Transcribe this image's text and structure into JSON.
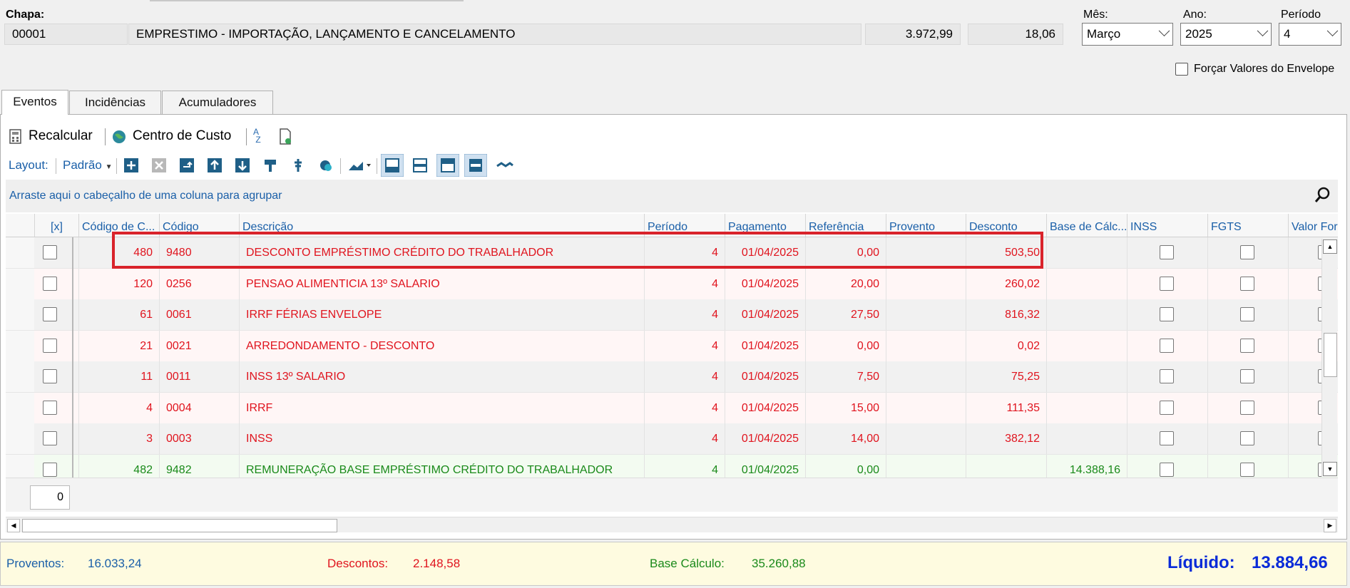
{
  "header": {
    "chapa_label": "Chapa:",
    "chapa_code": "00001",
    "chapa_name": "EMPRESTIMO - IMPORTAÇÃO, LANÇAMENTO E CANCELAMENTO",
    "value1": "3.972,99",
    "value2": "18,06",
    "mes_label": "Mês:",
    "mes_value": "Março",
    "ano_label": "Ano:",
    "ano_value": "2025",
    "periodo_label": "Período",
    "periodo_value": "4",
    "forcar_label": "Forçar Valores do Envelope"
  },
  "tabs": [
    {
      "label": "Eventos"
    },
    {
      "label": "Incidências"
    },
    {
      "label": "Acumuladores"
    }
  ],
  "toolbar": {
    "recalcular": "Recalcular",
    "centro_custo": "Centro de Custo",
    "layout_label": "Layout:",
    "layout_value": "Padrão"
  },
  "group_hint": "Arraste aqui o cabeçalho de uma coluna para agrupar",
  "columns": [
    "[x]",
    "Código de C...",
    "Código",
    "Descrição",
    "Período",
    "Pagamento",
    "Referência",
    "Provento",
    "Desconto",
    "Base de Cálc...",
    "INSS",
    "FGTS",
    "Valor Força"
  ],
  "rows": [
    {
      "cc": "480",
      "code": "9480",
      "desc": "DESCONTO EMPRÉSTIMO CRÉDITO DO TRABALHADOR",
      "periodo": "4",
      "pagamento": "01/04/2025",
      "referencia": "0,00",
      "provento": "",
      "desconto": "503,50",
      "base": ""
    },
    {
      "cc": "120",
      "code": "0256",
      "desc": "PENSAO ALIMENTICIA 13º SALARIO",
      "periodo": "4",
      "pagamento": "01/04/2025",
      "referencia": "20,00",
      "provento": "",
      "desconto": "260,02",
      "base": ""
    },
    {
      "cc": "61",
      "code": "0061",
      "desc": "IRRF FÉRIAS ENVELOPE",
      "periodo": "4",
      "pagamento": "01/04/2025",
      "referencia": "27,50",
      "provento": "",
      "desconto": "816,32",
      "base": ""
    },
    {
      "cc": "21",
      "code": "0021",
      "desc": "ARREDONDAMENTO - DESCONTO",
      "periodo": "4",
      "pagamento": "01/04/2025",
      "referencia": "0,00",
      "provento": "",
      "desconto": "0,02",
      "base": ""
    },
    {
      "cc": "11",
      "code": "0011",
      "desc": "INSS 13º SALARIO",
      "periodo": "4",
      "pagamento": "01/04/2025",
      "referencia": "7,50",
      "provento": "",
      "desconto": "75,25",
      "base": ""
    },
    {
      "cc": "4",
      "code": "0004",
      "desc": "IRRF",
      "periodo": "4",
      "pagamento": "01/04/2025",
      "referencia": "15,00",
      "provento": "",
      "desconto": "111,35",
      "base": ""
    },
    {
      "cc": "3",
      "code": "0003",
      "desc": "INSS",
      "periodo": "4",
      "pagamento": "01/04/2025",
      "referencia": "14,00",
      "provento": "",
      "desconto": "382,12",
      "base": ""
    },
    {
      "cc": "482",
      "code": "9482",
      "desc": "REMUNERAÇÃO BASE EMPRÉSTIMO CRÉDITO DO TRABALHADOR",
      "periodo": "4",
      "pagamento": "01/04/2025",
      "referencia": "0,00",
      "provento": "",
      "desconto": "",
      "base": "14.388,16"
    }
  ],
  "row_count": "0",
  "totals": {
    "proventos_label": "Proventos:",
    "proventos_value": "16.033,24",
    "descontos_label": "Descontos:",
    "descontos_value": "2.148,58",
    "base_label": "Base Cálculo:",
    "base_value": "35.260,88",
    "liquido_label": "Líquido:",
    "liquido_value": "13.884,66"
  },
  "colors": {
    "desconto": "#e0141e",
    "base": "#1a8a1a",
    "link": "#1a5fa8",
    "liquido": "#0a2bd8",
    "highlight": "#d9232b"
  }
}
